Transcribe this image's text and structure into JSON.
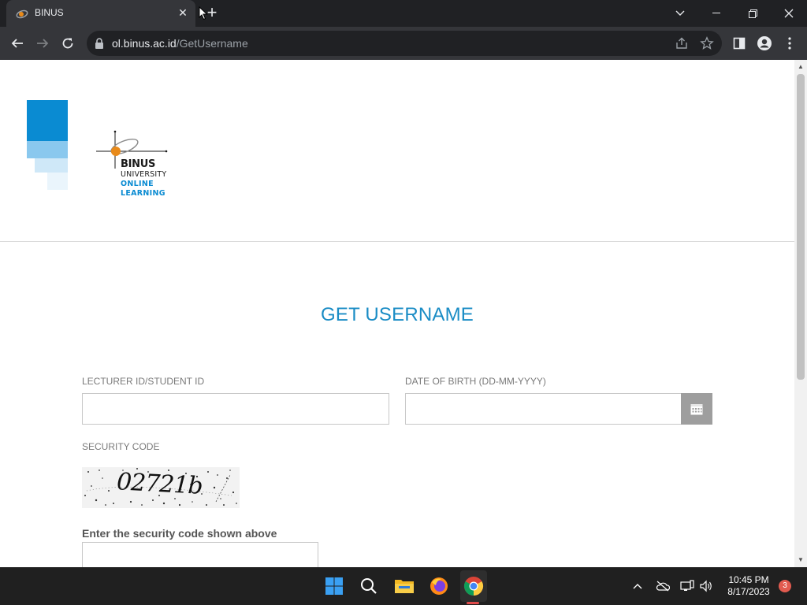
{
  "browser": {
    "tab_title": "BINUS",
    "tab_close": "✕",
    "new_tab": "+",
    "url_host": "ol.binus.ac.id",
    "url_path": "/GetUsername",
    "icons": [
      "back-arrow-icon",
      "forward-arrow-icon",
      "reload-icon",
      "lock-icon",
      "share-icon",
      "star-icon",
      "side-panel-icon",
      "profile-icon",
      "kebab-menu-icon"
    ]
  },
  "logo": {
    "line1": "BINUS",
    "line2": "UNIVERSITY",
    "line3": "ONLINE",
    "line4": "LEARNING"
  },
  "form": {
    "title": "GET USERNAME",
    "id_label": "LECTURER ID/STUDENT ID",
    "id_value": "",
    "dob_label": "DATE OF BIRTH (DD-MM-YYYY)",
    "dob_value": "",
    "security_label": "SECURITY CODE",
    "captcha_text": "02721b",
    "enter_label": "Enter the security code shown above",
    "code_value": ""
  },
  "taskbar": {
    "time": "10:45 PM",
    "date": "8/17/2023",
    "notification_count": "3"
  },
  "colors": {
    "accent": "#1a8cc5",
    "brand_blue": "#0a8bd2",
    "taskbar": "#202020"
  }
}
